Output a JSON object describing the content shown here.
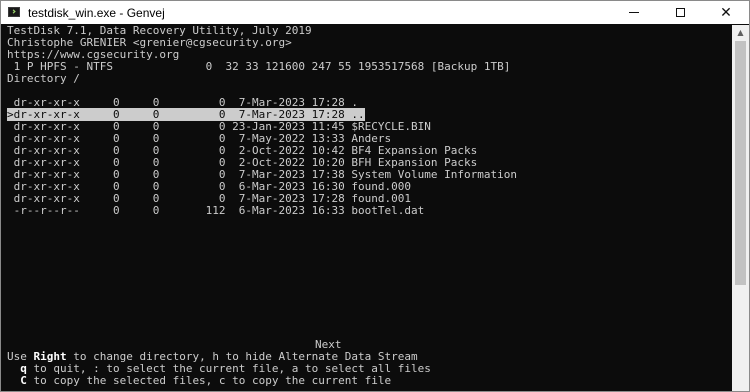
{
  "window": {
    "title": "testdisk_win.exe - Genvej",
    "min_label": "",
    "max_label": "",
    "close_label": "✕"
  },
  "console": {
    "header": [
      "TestDisk 7.1, Data Recovery Utility, July 2019",
      "Christophe GRENIER <grenier@cgsecurity.org>",
      "https://www.cgsecurity.org",
      " 1 P HPFS - NTFS              0  32 33 121600 247 55 1953517568 [Backup 1TB]",
      "Directory /"
    ],
    "entries": [
      {
        "line": " dr-xr-xr-x     0     0         0  7-Mar-2023 17:28 .",
        "selected": false
      },
      {
        "line": ">dr-xr-xr-x     0     0         0  7-Mar-2023 17:28 ..",
        "selected": true
      },
      {
        "line": " dr-xr-xr-x     0     0         0 23-Jan-2023 11:45 $RECYCLE.BIN",
        "selected": false
      },
      {
        "line": " dr-xr-xr-x     0     0         0  7-May-2022 13:33 Anders",
        "selected": false
      },
      {
        "line": " dr-xr-xr-x     0     0         0  2-Oct-2022 10:42 BF4 Expansion Packs",
        "selected": false
      },
      {
        "line": " dr-xr-xr-x     0     0         0  2-Oct-2022 10:20 BFH Expansion Packs",
        "selected": false
      },
      {
        "line": " dr-xr-xr-x     0     0         0  7-Mar-2023 17:38 System Volume Information",
        "selected": false
      },
      {
        "line": " dr-xr-xr-x     0     0         0  6-Mar-2023 16:30 found.000",
        "selected": false
      },
      {
        "line": " dr-xr-xr-x     0     0         0  7-Mar-2023 17:28 found.001",
        "selected": false
      },
      {
        "line": " -r--r--r--     0     0       112  6-Mar-2023 16:33 bootTel.dat",
        "selected": false
      }
    ],
    "next_label": "Next",
    "help": {
      "line1_prefix": "Use ",
      "line1_key": "Right",
      "line1_rest": " to change directory, h to hide Alternate Data Stream",
      "line2_key": "q",
      "line2_rest": " to quit, : to select the current file, a to select all files",
      "line3_key": "C",
      "line3_rest": " to copy the selected files, c to copy the current file"
    }
  },
  "colors": {
    "console_bg": "#0c0c0c",
    "console_fg": "#cccccc",
    "titlebar_bg": "#ffffff"
  }
}
